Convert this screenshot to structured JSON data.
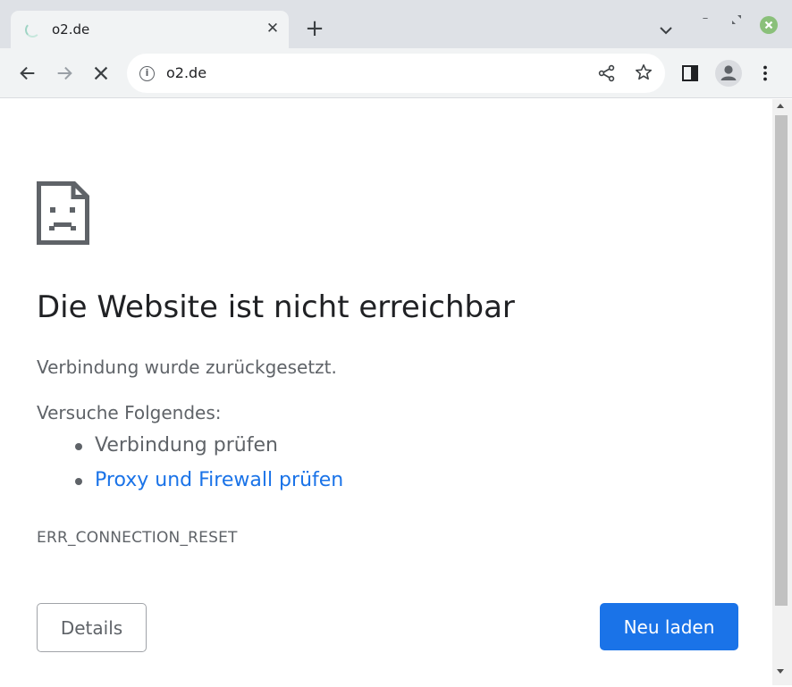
{
  "tab": {
    "title": "o2.de",
    "close_glyph": "✕",
    "new_tab_glyph": "+"
  },
  "toolbar": {
    "url": "o2.de",
    "info_glyph": "i"
  },
  "window": {
    "minimize_glyph": "–"
  },
  "page": {
    "heading": "Die Website ist nicht erreichbar",
    "subtext": "Verbindung wurde zurückgesetzt.",
    "try_label": "Versuche Folgendes:",
    "suggestions": [
      {
        "text": "Verbindung prüfen"
      },
      {
        "text": "Proxy und Firewall prüfen"
      }
    ],
    "error_code": "ERR_CONNECTION_RESET",
    "details_label": "Details",
    "reload_label": "Neu laden"
  },
  "colors": {
    "accent": "#1a73e8",
    "text": "#202124",
    "secondary": "#5f6368"
  },
  "icons": [
    "loading-spinner-icon",
    "close-icon",
    "plus-icon",
    "chevron-down-icon",
    "minimize-icon",
    "restore-icon",
    "window-close-icon",
    "back-arrow-icon",
    "forward-arrow-icon",
    "stop-icon",
    "info-icon",
    "share-icon",
    "star-icon",
    "side-panel-icon",
    "profile-icon",
    "kebab-menu-icon",
    "sad-document-icon"
  ]
}
